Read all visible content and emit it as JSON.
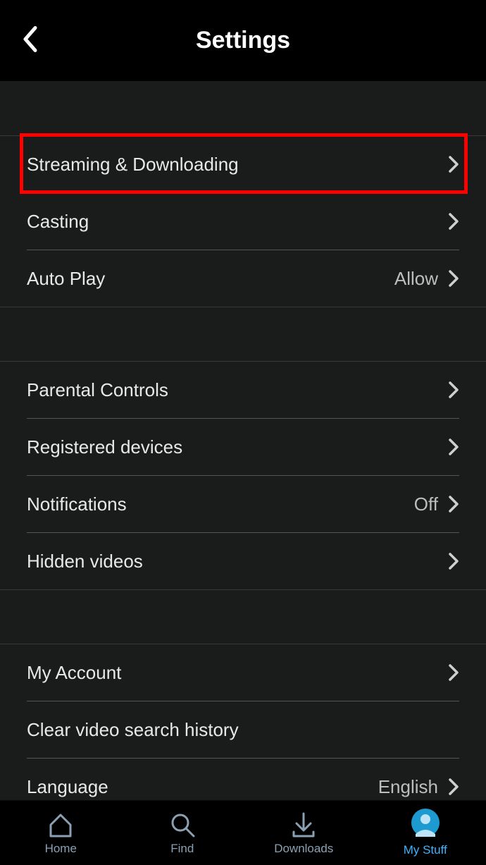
{
  "header": {
    "title": "Settings"
  },
  "groups": [
    {
      "rows": [
        {
          "label": "Streaming & Downloading",
          "value": "",
          "chevron": true
        },
        {
          "label": "Casting",
          "value": "",
          "chevron": true
        },
        {
          "label": "Auto Play",
          "value": "Allow",
          "chevron": true
        }
      ]
    },
    {
      "rows": [
        {
          "label": "Parental Controls",
          "value": "",
          "chevron": true
        },
        {
          "label": "Registered devices",
          "value": "",
          "chevron": true
        },
        {
          "label": "Notifications",
          "value": "Off",
          "chevron": true
        },
        {
          "label": "Hidden videos",
          "value": "",
          "chevron": true
        }
      ]
    },
    {
      "rows": [
        {
          "label": "My Account",
          "value": "",
          "chevron": true
        },
        {
          "label": "Clear video search history",
          "value": "",
          "chevron": false
        },
        {
          "label": "Language",
          "value": "English",
          "chevron": true
        }
      ]
    }
  ],
  "tabs": [
    {
      "label": "Home"
    },
    {
      "label": "Find"
    },
    {
      "label": "Downloads"
    },
    {
      "label": "My Stuff"
    }
  ]
}
